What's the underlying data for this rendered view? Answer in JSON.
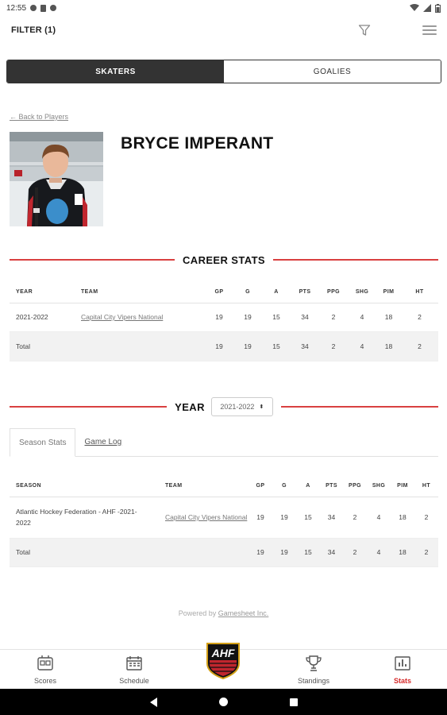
{
  "status_bar": {
    "time": "12:55"
  },
  "header": {
    "filter_label": "FILTER (1)"
  },
  "tabs": {
    "skaters": "SKATERS",
    "goalies": "GOALIES"
  },
  "back_link": "← Back to Players",
  "player": {
    "name": "BRYCE IMPERANT"
  },
  "career": {
    "title": "CAREER STATS",
    "columns": [
      "YEAR",
      "TEAM",
      "GP",
      "G",
      "A",
      "PTS",
      "PPG",
      "SHG",
      "PIM",
      "HT"
    ],
    "row": {
      "year": "2021-2022",
      "team": "Capital City Vipers National",
      "gp": "19",
      "g": "19",
      "a": "15",
      "pts": "34",
      "ppg": "2",
      "shg": "4",
      "pim": "18",
      "ht": "2"
    },
    "total": {
      "label": "Total",
      "gp": "19",
      "g": "19",
      "a": "15",
      "pts": "34",
      "ppg": "2",
      "shg": "4",
      "pim": "18",
      "ht": "2"
    }
  },
  "year_selector": {
    "label": "YEAR",
    "value": "2021-2022"
  },
  "subtabs": {
    "season_stats": "Season Stats",
    "game_log": "Game Log"
  },
  "season": {
    "columns": [
      "SEASON",
      "TEAM",
      "GP",
      "G",
      "A",
      "PTS",
      "PPG",
      "SHG",
      "PIM",
      "HT"
    ],
    "row": {
      "season": "Atlantic Hockey Federation - AHF -2021-2022",
      "team": "Capital City Vipers National",
      "gp": "19",
      "g": "19",
      "a": "15",
      "pts": "34",
      "ppg": "2",
      "shg": "4",
      "pim": "18",
      "ht": "2"
    },
    "total": {
      "label": "Total",
      "gp": "19",
      "g": "19",
      "a": "15",
      "pts": "34",
      "ppg": "2",
      "shg": "4",
      "pim": "18",
      "ht": "2"
    }
  },
  "powered_by": {
    "prefix": "Powered by",
    "link": "Gamesheet Inc."
  },
  "bottom_nav": {
    "scores": "Scores",
    "schedule": "Schedule",
    "logo_text": "AHF",
    "standings": "Standings",
    "stats": "Stats"
  },
  "colors": {
    "accent_red": "#d62b2b",
    "dark": "#333333"
  }
}
